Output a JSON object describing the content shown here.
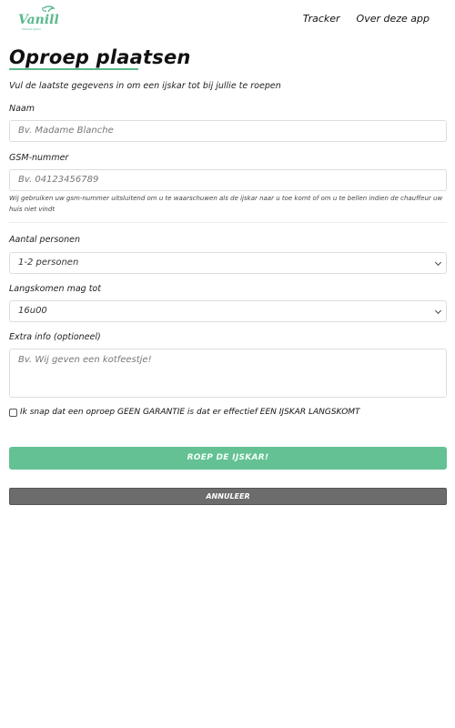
{
  "header": {
    "logo_text": "Vanilla",
    "logo_subtext": "Mobiele IJsbar",
    "nav": {
      "tracker": "Tracker",
      "about": "Over deze app"
    }
  },
  "form": {
    "title": "Oproep plaatsen",
    "intro": "Vul de laatste gegevens in om een ijskar tot bij jullie te roepen",
    "name": {
      "label": "Naam",
      "placeholder": "Bv. Madame Blanche"
    },
    "phone": {
      "label": "GSM-nummer",
      "placeholder": "Bv. 04123456789",
      "help": "Wij gebruiken uw gsm-nummer uitsluitend om u te waarschuwen als de ijskar naar u toe komt of om u te bellen indien de chauffeur uw huis niet vindt"
    },
    "persons": {
      "label": "Aantal personen",
      "value": "1-2 personen"
    },
    "until": {
      "label": "Langskomen mag tot",
      "value": "16u00"
    },
    "extra": {
      "label": "Extra info (optioneel)",
      "placeholder": "Bv. Wij geven een kotfeestje!"
    },
    "consent": {
      "label": "Ik snap dat een oproep GEEN GARANTIE is dat er effectief EEN IJSKAR LANGSKOMT",
      "checked": false
    },
    "submit_label": "ROEP DE IJSKAR!",
    "cancel_label": "ANNULEER"
  },
  "colors": {
    "accent": "#63c193",
    "underline": "#5bb98d",
    "cancel": "#6c6c6c"
  }
}
